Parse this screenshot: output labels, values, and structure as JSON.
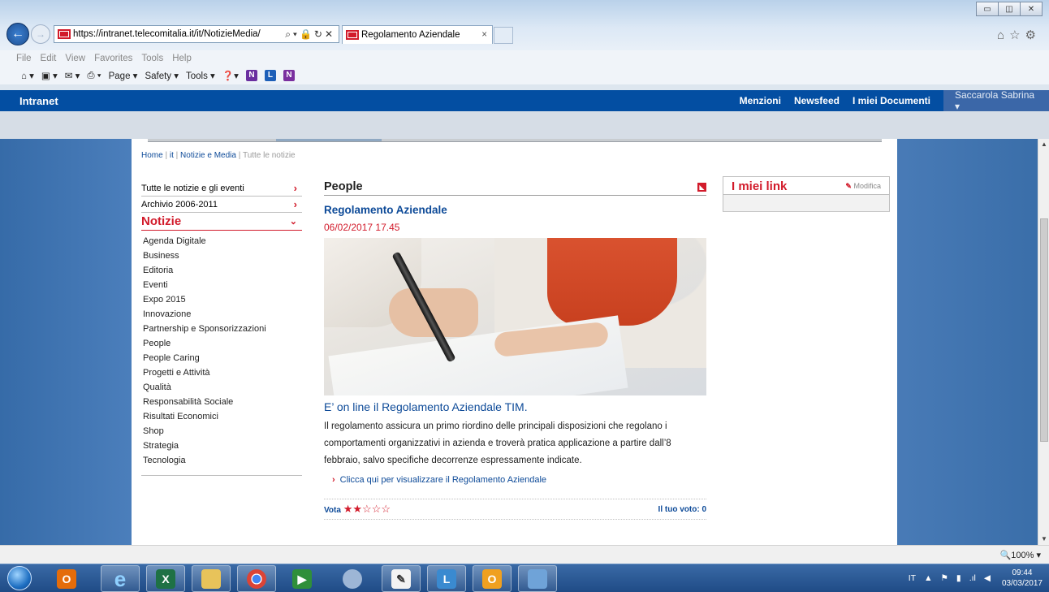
{
  "browser": {
    "url": "https://intranet.telecomitalia.it/it/NotizieMedia/",
    "tab_title": "Regolamento Aziendale",
    "tab_close": "×",
    "menu": [
      "File",
      "Edit",
      "View",
      "Favorites",
      "Tools",
      "Help"
    ],
    "command_bar": {
      "page_label": "Page ▾",
      "safety_label": "Safety ▾",
      "tools_label": "Tools ▾"
    },
    "zoom": "🔍100%  ▾"
  },
  "intranet": {
    "title": "Intranet",
    "links": [
      "Menzioni",
      "Newsfeed",
      "I miei Documenti"
    ],
    "user": "Saccarola Sabrina ▾"
  },
  "breadcrumb": {
    "home": "Home",
    "it": "it",
    "notizie_media": "Notizie e Media",
    "current": "Tutte le notizie",
    "sep": "|"
  },
  "leftnav": {
    "top_items": [
      {
        "label": "Tutte le notizie e gli eventi",
        "chevron": "›"
      },
      {
        "label": "Archivio 2006-2011",
        "chevron": "›"
      }
    ],
    "active": {
      "label": "Notizie",
      "chevron": "⌄"
    },
    "subcategories": [
      "Agenda Digitale",
      "Business",
      "Editoria",
      "Eventi",
      "Expo 2015",
      "Innovazione",
      "Partnership e Sponsorizzazioni",
      "People",
      "People Caring",
      "Progetti e Attività",
      "Qualità",
      "Responsabilità Sociale",
      "Risultati Economici",
      "Shop",
      "Strategia",
      "Tecnologia"
    ]
  },
  "article": {
    "section": "People",
    "title": "Regolamento Aziendale",
    "date": "06/02/2017 17.45",
    "subtitle": "E’ on line il Regolamento Aziendale TIM.",
    "body_lines": [
      "Il regolamento assicura un primo riordino delle principali disposizioni che regolano i",
      "comportamenti organizzativi in azienda e troverà pratica applicazione a partire dall’8",
      "febbraio, salvo specifiche decorrenze espressamente indicate."
    ],
    "link_arrow": "›",
    "link_text": "Clicca qui per visualizzare il Regolamento Aziendale",
    "vote_label": "Vota",
    "rating": 2,
    "rating_max": 5,
    "your_vote_label": "Il tuo voto:",
    "your_vote": "0"
  },
  "mylinks": {
    "title": "I miei link",
    "edit": "Modifica"
  },
  "taskbar": {
    "lang": "IT",
    "time": "09:44",
    "date": "03/03/2017"
  },
  "colors": {
    "brand_blue": "#034ea2",
    "accent_red": "#d21b2b",
    "link_blue": "#0d4a98"
  }
}
